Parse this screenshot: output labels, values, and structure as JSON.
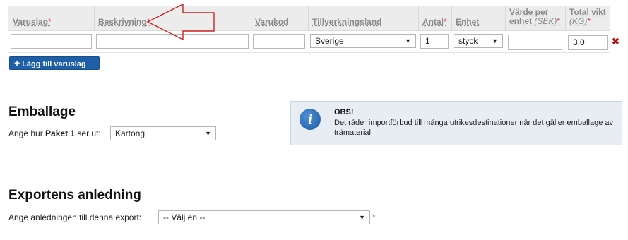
{
  "goods_table": {
    "columns": {
      "varuslag": {
        "label": "Varuslag",
        "req": "*"
      },
      "beskrivning": {
        "label": "Beskrivning",
        "req": "*"
      },
      "varukod": {
        "label": "Varukod"
      },
      "tillverkningsland": {
        "label": "Tillverkningsland"
      },
      "antal": {
        "label": "Antal",
        "req": "*"
      },
      "enhet": {
        "label": "Enhet"
      },
      "varde": {
        "line1": "Värde per",
        "line2": "enhet ",
        "unit": "(SEK)",
        "req": "*"
      },
      "vikt": {
        "line1": "Total vikt",
        "unit": "(KG)",
        "req": "*"
      }
    },
    "row": {
      "varuslag": "",
      "beskrivning": "",
      "varukod": "",
      "tillverkningsland": "Sverige",
      "antal": "1",
      "enhet": "styck",
      "varde": "",
      "vikt": "3,0"
    },
    "remove_icon": "✖",
    "add_button": {
      "icon": "+",
      "label": "Lägg till varuslag"
    }
  },
  "emballage": {
    "heading": "Emballage",
    "prompt_pre": "Ange hur ",
    "prompt_bold": "Paket 1",
    "prompt_post": " ser ut:",
    "selected": "Kartong"
  },
  "notice": {
    "icon": "i",
    "title": "OBS!",
    "text": "Det råder importförbud till många utrikesdestinationer när det gäller emballage av trämaterial."
  },
  "export": {
    "heading": "Exportens anledning",
    "prompt": "Ange anledningen till denna export:",
    "selected": "-- Välj en --",
    "req": "*"
  },
  "colors": {
    "accent": "#1f5fa8",
    "required": "#dd3333",
    "arrow": "#cc2222"
  },
  "dropdown_icon": "▼"
}
